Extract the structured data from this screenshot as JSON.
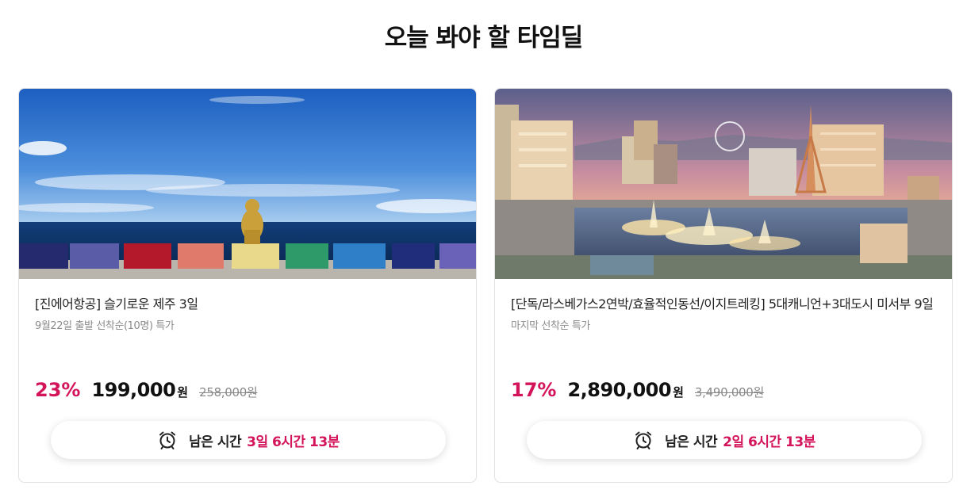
{
  "section": {
    "title": "오늘 봐야 할 타임딜"
  },
  "colors": {
    "accent": "#d4145a",
    "card_border": "#e1e1e1"
  },
  "deals": [
    {
      "image": "jeju-coast-photo",
      "title": "[진에어항공] 슬기로운 제주 3일",
      "subtitle": "9월22일 출발 선착순(10명) 특가",
      "discount": "23%",
      "price": "199,000",
      "currency": "원",
      "original_price": "258,000원",
      "timer_icon": "alarm-clock-icon",
      "timer_label": "남은 시간",
      "timer_value": "3일 6시간 13분"
    },
    {
      "image": "las-vegas-photo",
      "title": "[단독/라스베가스2연박/효율적인동선/이지트레킹] 5대캐니언+3대도시 미서부 9일",
      "subtitle": "마지막 선착순 특가",
      "discount": "17%",
      "price": "2,890,000",
      "currency": "원",
      "original_price": "3,490,000원",
      "timer_icon": "alarm-clock-icon",
      "timer_label": "남은 시간",
      "timer_value": "2일 6시간 13분"
    }
  ]
}
